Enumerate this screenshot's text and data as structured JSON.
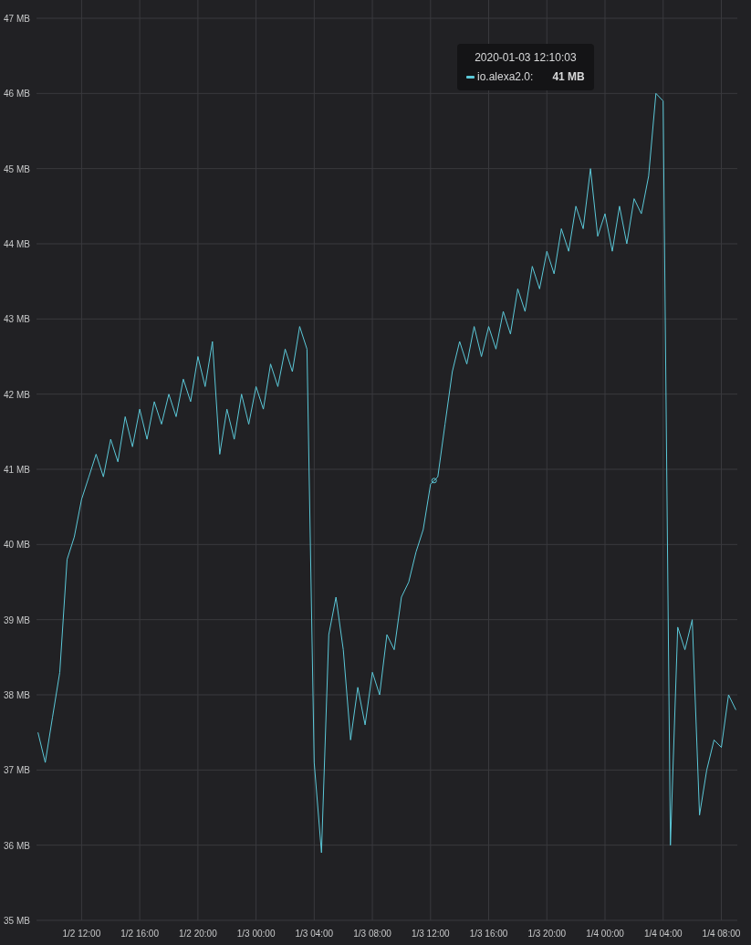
{
  "chart_data": {
    "type": "line",
    "grid": true,
    "ylim": [
      35,
      47
    ],
    "yticks": [
      {
        "value": 35,
        "label": "35 MB"
      },
      {
        "value": 36,
        "label": "36 MB"
      },
      {
        "value": 37,
        "label": "37 MB"
      },
      {
        "value": 38,
        "label": "38 MB"
      },
      {
        "value": 39,
        "label": "39 MB"
      },
      {
        "value": 40,
        "label": "40 MB"
      },
      {
        "value": 41,
        "label": "41 MB"
      },
      {
        "value": 42,
        "label": "42 MB"
      },
      {
        "value": 43,
        "label": "43 MB"
      },
      {
        "value": 44,
        "label": "44 MB"
      },
      {
        "value": 45,
        "label": "45 MB"
      },
      {
        "value": 46,
        "label": "46 MB"
      },
      {
        "value": 47,
        "label": "47 MB"
      }
    ],
    "categories": [
      null,
      null,
      null,
      null,
      null,
      null,
      "1/2 12:00",
      null,
      null,
      null,
      null,
      null,
      null,
      null,
      "1/2 16:00",
      null,
      null,
      null,
      null,
      null,
      null,
      null,
      "1/2 20:00",
      null,
      null,
      null,
      null,
      null,
      null,
      null,
      "1/3 00:00",
      null,
      null,
      null,
      null,
      null,
      null,
      null,
      "1/3 04:00",
      null,
      null,
      null,
      null,
      null,
      null,
      null,
      "1/3 08:00",
      null,
      null,
      null,
      null,
      null,
      null,
      null,
      "1/3 12:00",
      null,
      null,
      null,
      null,
      null,
      null,
      null,
      "1/3 16:00",
      null,
      null,
      null,
      null,
      null,
      null,
      null,
      "1/3 20:00",
      null,
      null,
      null,
      null,
      null,
      null,
      null,
      "1/4 00:00",
      null,
      null,
      null,
      null,
      null,
      null,
      null,
      "1/4 04:00",
      null,
      null,
      null,
      null,
      null,
      null,
      null,
      "1/4 08:00",
      null,
      null
    ],
    "series": [
      {
        "color": "#5bc8d8",
        "values": [
          37.5,
          37.1,
          37.7,
          38.3,
          39.8,
          40.1,
          40.6,
          40.9,
          41.2,
          40.9,
          41.4,
          41.1,
          41.7,
          41.3,
          41.8,
          41.4,
          41.9,
          41.6,
          42.0,
          41.7,
          42.2,
          41.9,
          42.5,
          42.1,
          42.7,
          41.2,
          41.8,
          41.4,
          42.0,
          41.6,
          42.1,
          41.8,
          42.4,
          42.1,
          42.6,
          42.3,
          42.9,
          42.6,
          37.1,
          35.9,
          38.8,
          39.3,
          38.6,
          37.4,
          38.1,
          37.6,
          38.3,
          38.0,
          38.8,
          38.6,
          39.3,
          39.5,
          39.9,
          40.2,
          40.8,
          40.9,
          41.6,
          42.3,
          42.7,
          42.4,
          42.9,
          42.5,
          42.9,
          42.6,
          43.1,
          42.8,
          43.4,
          43.1,
          43.7,
          43.4,
          43.9,
          43.6,
          44.2,
          43.9,
          44.5,
          44.2,
          45.0,
          44.1,
          44.4,
          43.9,
          44.5,
          44.0,
          44.6,
          44.4,
          44.9,
          46.0,
          45.9,
          36.0,
          38.9,
          38.6,
          39.0,
          36.4,
          37.0,
          37.4,
          37.3,
          38.0,
          37.8
        ]
      }
    ]
  },
  "tooltip": {
    "title": "2020-01-03 12:10:03",
    "label": "io.alexa2.0:",
    "value": "41 MB"
  }
}
